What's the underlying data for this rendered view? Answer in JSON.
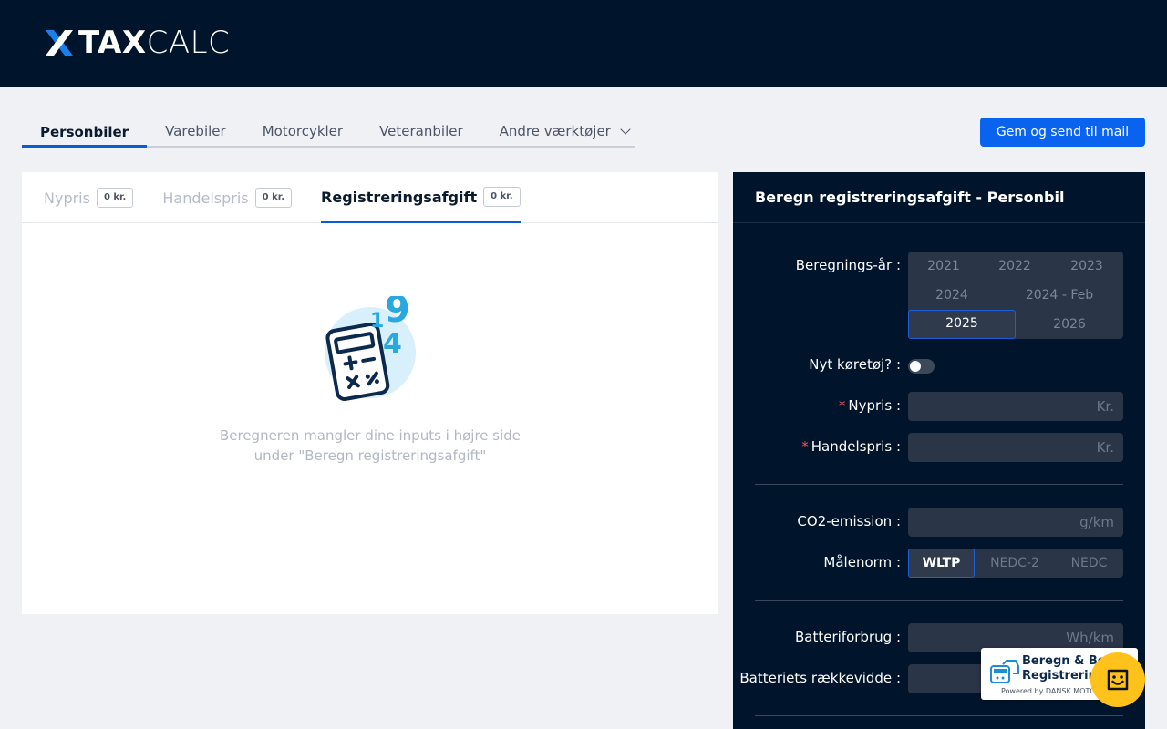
{
  "header": {
    "logo_bold": "TAX",
    "logo_light": "CALC",
    "logo_icon": "x-logo-icon"
  },
  "nav": {
    "tabs": [
      {
        "label": "Personbiler",
        "active": true
      },
      {
        "label": "Varebiler",
        "active": false
      },
      {
        "label": "Motorcykler",
        "active": false
      },
      {
        "label": "Veteranbiler",
        "active": false
      },
      {
        "label": "Andre værktøjer",
        "active": false,
        "dropdown": true
      }
    ],
    "mail_button": "Gem og send til mail"
  },
  "result": {
    "subtabs": [
      {
        "label": "Nypris",
        "badge": "0 kr.",
        "active": false
      },
      {
        "label": "Handelspris",
        "badge": "0 kr.",
        "active": false
      },
      {
        "label": "Registreringsafgift",
        "badge": "0 kr.",
        "active": true
      }
    ],
    "empty_line1": "Beregneren mangler dine inputs i højre side",
    "empty_line2": "under \"Beregn registreringsafgift\"",
    "calc_icon": "calculator-icon",
    "calc_digits": [
      "1",
      "9",
      "4"
    ]
  },
  "form": {
    "title": "Beregn registreringsafgift - Personbil",
    "year_label": "Beregnings-år",
    "years": [
      "2021",
      "2022",
      "2023",
      "2024",
      "2024 - Feb",
      "2025",
      "2026"
    ],
    "selected_year": "2025",
    "new_vehicle_label": "Nyt køretøj?",
    "new_vehicle_on": false,
    "nypris_label": "Nypris",
    "nypris_unit": "Kr.",
    "handelspris_label": "Handelspris",
    "handelspris_unit": "Kr.",
    "co2_label": "CO2-emission",
    "co2_unit": "g/km",
    "norm_label": "Målenorm",
    "norms": [
      "WLTP",
      "NEDC-2",
      "NEDC"
    ],
    "selected_norm": "WLTP",
    "battery_label": "Batteriforbrug",
    "battery_unit": "Wh/km",
    "range_label": "Batteriets rækkevidde",
    "colon": ":"
  },
  "promo": {
    "line1": "Beregn & Beta",
    "line2": "Registrering",
    "line3": "Powered by DANSK MOTOR"
  },
  "chat": {
    "icon": "smile-chat-icon"
  },
  "colors": {
    "header_bg": "#00142b",
    "accent": "#0a63ef",
    "chat": "#ffc21a"
  }
}
